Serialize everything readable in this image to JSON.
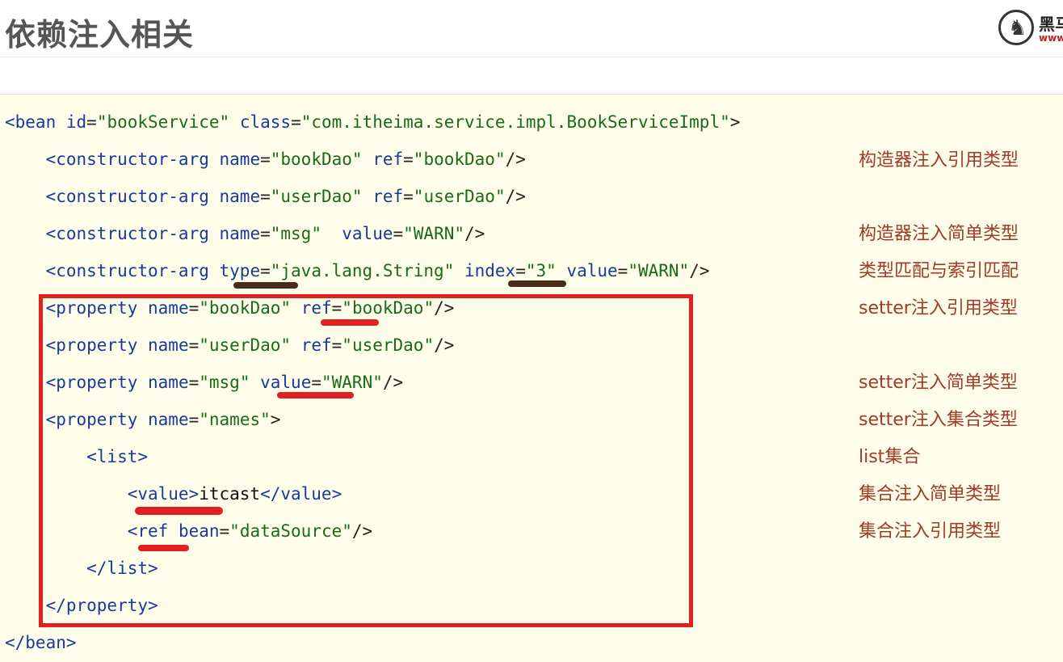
{
  "header": {
    "title": "依赖注入相关",
    "logo": {
      "cn": "黑马",
      "url": "www."
    }
  },
  "code_lines": [
    {
      "id": "bean-open",
      "parts": [
        {
          "c": "tag",
          "t": "<bean "
        },
        {
          "c": "tag",
          "t": "id"
        },
        {
          "c": "punct",
          "t": "="
        },
        {
          "c": "val",
          "t": "\"bookService\""
        },
        {
          "c": "punct",
          "t": " "
        },
        {
          "c": "tag",
          "t": "class"
        },
        {
          "c": "punct",
          "t": "="
        },
        {
          "c": "val",
          "t": "\"com.itheima.service.impl.BookServiceImpl\""
        },
        {
          "c": "punct",
          "t": ">"
        }
      ]
    },
    {
      "id": "ctor-bookdao",
      "parts": [
        {
          "c": "tag",
          "t": "    <constructor-arg "
        },
        {
          "c": "tag",
          "t": "name"
        },
        {
          "c": "punct",
          "t": "="
        },
        {
          "c": "val",
          "t": "\"bookDao\""
        },
        {
          "c": "punct",
          "t": " "
        },
        {
          "c": "tag",
          "t": "ref"
        },
        {
          "c": "punct",
          "t": "="
        },
        {
          "c": "val",
          "t": "\"bookDao\""
        },
        {
          "c": "punct",
          "t": "/>"
        }
      ]
    },
    {
      "id": "ctor-userdao",
      "parts": [
        {
          "c": "tag",
          "t": "    <constructor-arg "
        },
        {
          "c": "tag",
          "t": "name"
        },
        {
          "c": "punct",
          "t": "="
        },
        {
          "c": "val",
          "t": "\"userDao\""
        },
        {
          "c": "punct",
          "t": " "
        },
        {
          "c": "tag",
          "t": "ref"
        },
        {
          "c": "punct",
          "t": "="
        },
        {
          "c": "val",
          "t": "\"userDao\""
        },
        {
          "c": "punct",
          "t": "/>"
        }
      ]
    },
    {
      "id": "ctor-msg",
      "parts": [
        {
          "c": "tag",
          "t": "    <constructor-arg "
        },
        {
          "c": "tag",
          "t": "name"
        },
        {
          "c": "punct",
          "t": "="
        },
        {
          "c": "val",
          "t": "\"msg\""
        },
        {
          "c": "punct",
          "t": "  "
        },
        {
          "c": "tag",
          "t": "value"
        },
        {
          "c": "punct",
          "t": "="
        },
        {
          "c": "val",
          "t": "\"WARN\""
        },
        {
          "c": "punct",
          "t": "/>"
        }
      ]
    },
    {
      "id": "ctor-type-index",
      "parts": [
        {
          "c": "tag",
          "t": "    <constructor-arg "
        },
        {
          "c": "tag",
          "t": "type"
        },
        {
          "c": "punct",
          "t": "="
        },
        {
          "c": "val",
          "t": "\"java.lang.String\""
        },
        {
          "c": "punct",
          "t": " "
        },
        {
          "c": "tag",
          "t": "index"
        },
        {
          "c": "punct",
          "t": "="
        },
        {
          "c": "val",
          "t": "\"3\""
        },
        {
          "c": "punct",
          "t": " "
        },
        {
          "c": "tag",
          "t": "value"
        },
        {
          "c": "punct",
          "t": "="
        },
        {
          "c": "val",
          "t": "\"WARN\""
        },
        {
          "c": "punct",
          "t": "/>"
        }
      ]
    },
    {
      "id": "prop-bookdao",
      "parts": [
        {
          "c": "tag",
          "t": "    <property "
        },
        {
          "c": "tag",
          "t": "name"
        },
        {
          "c": "punct",
          "t": "="
        },
        {
          "c": "val",
          "t": "\"bookDao\""
        },
        {
          "c": "punct",
          "t": " "
        },
        {
          "c": "tag",
          "t": "ref"
        },
        {
          "c": "punct",
          "t": "="
        },
        {
          "c": "val",
          "t": "\"bookDao\""
        },
        {
          "c": "punct",
          "t": "/>"
        }
      ]
    },
    {
      "id": "prop-userdao",
      "parts": [
        {
          "c": "tag",
          "t": "    <property "
        },
        {
          "c": "tag",
          "t": "name"
        },
        {
          "c": "punct",
          "t": "="
        },
        {
          "c": "val",
          "t": "\"userDao\""
        },
        {
          "c": "punct",
          "t": " "
        },
        {
          "c": "tag",
          "t": "ref"
        },
        {
          "c": "punct",
          "t": "="
        },
        {
          "c": "val",
          "t": "\"userDao\""
        },
        {
          "c": "punct",
          "t": "/>"
        }
      ]
    },
    {
      "id": "prop-msg",
      "parts": [
        {
          "c": "tag",
          "t": "    <property "
        },
        {
          "c": "tag",
          "t": "name"
        },
        {
          "c": "punct",
          "t": "="
        },
        {
          "c": "val",
          "t": "\"msg\""
        },
        {
          "c": "punct",
          "t": " "
        },
        {
          "c": "tag",
          "t": "value"
        },
        {
          "c": "punct",
          "t": "="
        },
        {
          "c": "val",
          "t": "\"WARN\""
        },
        {
          "c": "punct",
          "t": "/>"
        }
      ]
    },
    {
      "id": "prop-names",
      "parts": [
        {
          "c": "tag",
          "t": "    <property "
        },
        {
          "c": "tag",
          "t": "name"
        },
        {
          "c": "punct",
          "t": "="
        },
        {
          "c": "val",
          "t": "\"names\""
        },
        {
          "c": "punct",
          "t": ">"
        }
      ]
    },
    {
      "id": "list-open",
      "parts": [
        {
          "c": "tag",
          "t": "        <list>"
        }
      ]
    },
    {
      "id": "value-itcast",
      "parts": [
        {
          "c": "tag",
          "t": "            <value>"
        },
        {
          "c": "txt",
          "t": "itcast"
        },
        {
          "c": "tag",
          "t": "</value>"
        }
      ]
    },
    {
      "id": "ref-datasource",
      "parts": [
        {
          "c": "tag",
          "t": "            <ref "
        },
        {
          "c": "tag",
          "t": "bean"
        },
        {
          "c": "punct",
          "t": "="
        },
        {
          "c": "val",
          "t": "\"dataSource\""
        },
        {
          "c": "punct",
          "t": "/>"
        }
      ]
    },
    {
      "id": "list-close",
      "parts": [
        {
          "c": "tag",
          "t": "        </list>"
        }
      ]
    },
    {
      "id": "prop-close",
      "parts": [
        {
          "c": "tag",
          "t": "    </property>"
        }
      ]
    },
    {
      "id": "bean-close",
      "parts": [
        {
          "c": "tag",
          "t": "</bean>"
        }
      ]
    }
  ],
  "notes": [
    "构造器注入引用类型",
    "构造器注入简单类型",
    "类型匹配与索引匹配",
    "setter注入引用类型",
    "setter注入简单类型",
    "setter注入集合类型",
    "list集合",
    "集合注入简单类型",
    "集合注入引用类型"
  ],
  "colors": {
    "tag": "#1a3a9a",
    "value": "#1a6a1a",
    "note": "#a03a2a",
    "highlight_box": "#e32020",
    "panel_bg": "#fefde9"
  }
}
